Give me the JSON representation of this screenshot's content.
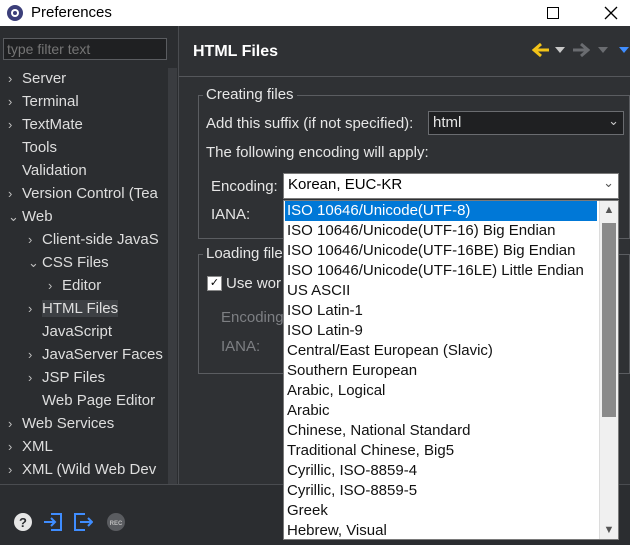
{
  "window": {
    "title": "Preferences",
    "minimize": "—",
    "maximize": "☐",
    "close": "✕"
  },
  "filter": {
    "placeholder": "type filter text"
  },
  "tree": [
    {
      "label": "Server",
      "twisty": "›",
      "depth": 0
    },
    {
      "label": "Terminal",
      "twisty": "›",
      "depth": 0
    },
    {
      "label": "TextMate",
      "twisty": "›",
      "depth": 0
    },
    {
      "label": "Tools",
      "twisty": "",
      "depth": 0
    },
    {
      "label": "Validation",
      "twisty": "",
      "depth": 0
    },
    {
      "label": "Version Control (Tea",
      "twisty": "›",
      "depth": 0
    },
    {
      "label": "Web",
      "twisty": "⌄",
      "depth": 0
    },
    {
      "label": "Client-side JavaS",
      "twisty": "›",
      "depth": 1
    },
    {
      "label": "CSS Files",
      "twisty": "⌄",
      "depth": 1
    },
    {
      "label": "Editor",
      "twisty": "›",
      "depth": 2
    },
    {
      "label": "HTML Files",
      "twisty": "›",
      "depth": 1,
      "selected": true
    },
    {
      "label": "JavaScript",
      "twisty": "",
      "depth": 1
    },
    {
      "label": "JavaServer Faces",
      "twisty": "›",
      "depth": 1
    },
    {
      "label": "JSP Files",
      "twisty": "›",
      "depth": 1
    },
    {
      "label": "Web Page Editor",
      "twisty": "",
      "depth": 1
    },
    {
      "label": "Web Services",
      "twisty": "›",
      "depth": 0
    },
    {
      "label": "XML",
      "twisty": "›",
      "depth": 0
    },
    {
      "label": "XML (Wild Web Dev",
      "twisty": "›",
      "depth": 0
    }
  ],
  "page": {
    "title": "HTML Files",
    "creating_group": "Creating files",
    "suffix_label": "Add this suffix (if not specified):",
    "suffix_value": "html",
    "encoding_note": "The following encoding will apply:",
    "encoding_label": "Encoding:",
    "encoding_value": "Korean, EUC-KR",
    "iana_label": "IANA:",
    "loading_group": "Loading file",
    "use_workspace": "Use wor",
    "encoding_label2": "Encoding",
    "iana_label2": "IANA:"
  },
  "dropdown": {
    "items": [
      "ISO 10646/Unicode(UTF-8)",
      "ISO 10646/Unicode(UTF-16) Big Endian",
      "ISO 10646/Unicode(UTF-16BE) Big Endian",
      "ISO 10646/Unicode(UTF-16LE) Little Endian",
      "US ASCII",
      "ISO Latin-1",
      "ISO Latin-9",
      "Central/East European (Slavic)",
      "Southern European",
      "Arabic, Logical",
      "Arabic",
      "Chinese, National Standard",
      "Traditional Chinese, Big5",
      "Cyrillic, ISO-8859-4",
      "Cyrillic, ISO-8859-5",
      "Greek",
      "Hebrew, Visual"
    ],
    "selected_index": 0
  },
  "bottom": {
    "rec_label": "REC"
  },
  "colors": {
    "accent_yellow": "#f2c318",
    "accent_blue": "#3f8dff",
    "selection": "#0078d7"
  }
}
